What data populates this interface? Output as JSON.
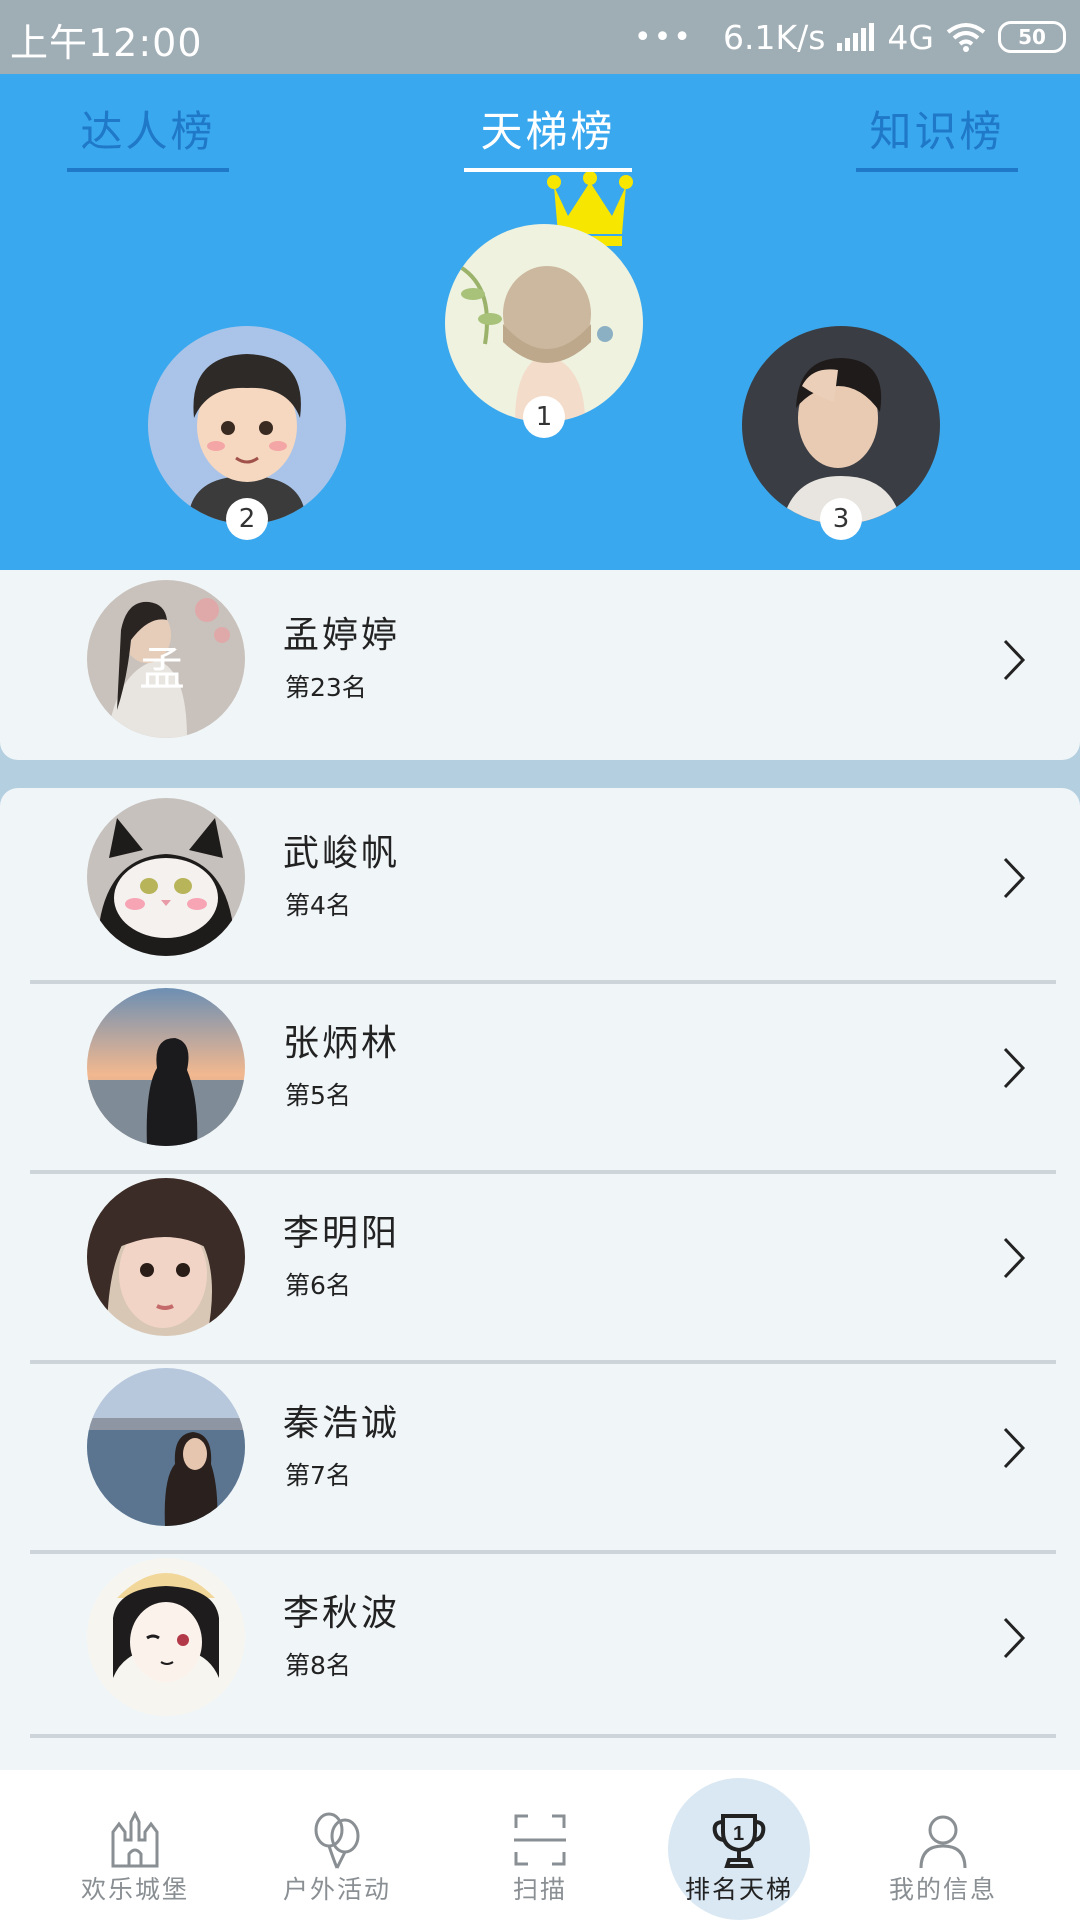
{
  "status_bar": {
    "time": "上午12:00",
    "dots": "•••",
    "network_speed": "6.1K/s",
    "network_type": "4G",
    "battery": "50"
  },
  "tabs": [
    {
      "label": "达人榜",
      "active": false
    },
    {
      "label": "天梯榜",
      "active": true
    },
    {
      "label": "知识榜",
      "active": false
    }
  ],
  "podium": [
    {
      "rank": "2",
      "avatar": "cartoon-boy-avatar"
    },
    {
      "rank": "1",
      "avatar": "girl-illustration-avatar",
      "crown": "crown-icon"
    },
    {
      "rank": "3",
      "avatar": "young-man-photo-avatar"
    }
  ],
  "my_entry": {
    "name": "孟婷婷",
    "rank": "第23名"
  },
  "list": [
    {
      "name": "武峻帆",
      "rank": "第4名"
    },
    {
      "name": "张炳林",
      "rank": "第5名"
    },
    {
      "name": "李明阳",
      "rank": "第6名"
    },
    {
      "name": "秦浩诚",
      "rank": "第7名"
    },
    {
      "name": "李秋波",
      "rank": "第8名"
    }
  ],
  "nav": [
    {
      "label": "欢乐城堡",
      "icon": "castle-icon",
      "active": false
    },
    {
      "label": "户外活动",
      "icon": "balloon-icon",
      "active": false
    },
    {
      "label": "扫描",
      "icon": "scan-icon",
      "active": false
    },
    {
      "label": "排名天梯",
      "icon": "trophy-icon",
      "active": true
    },
    {
      "label": "我的信息",
      "icon": "person-icon",
      "active": false
    }
  ],
  "colors": {
    "header_bg": "#3aa8ee",
    "status_bar_bg": "#9fadb5",
    "inactive_tab": "#1f78c8",
    "crown": "#f7e600",
    "card_bg": "#f0f5f8",
    "page_bg": "#b4cfe0"
  }
}
